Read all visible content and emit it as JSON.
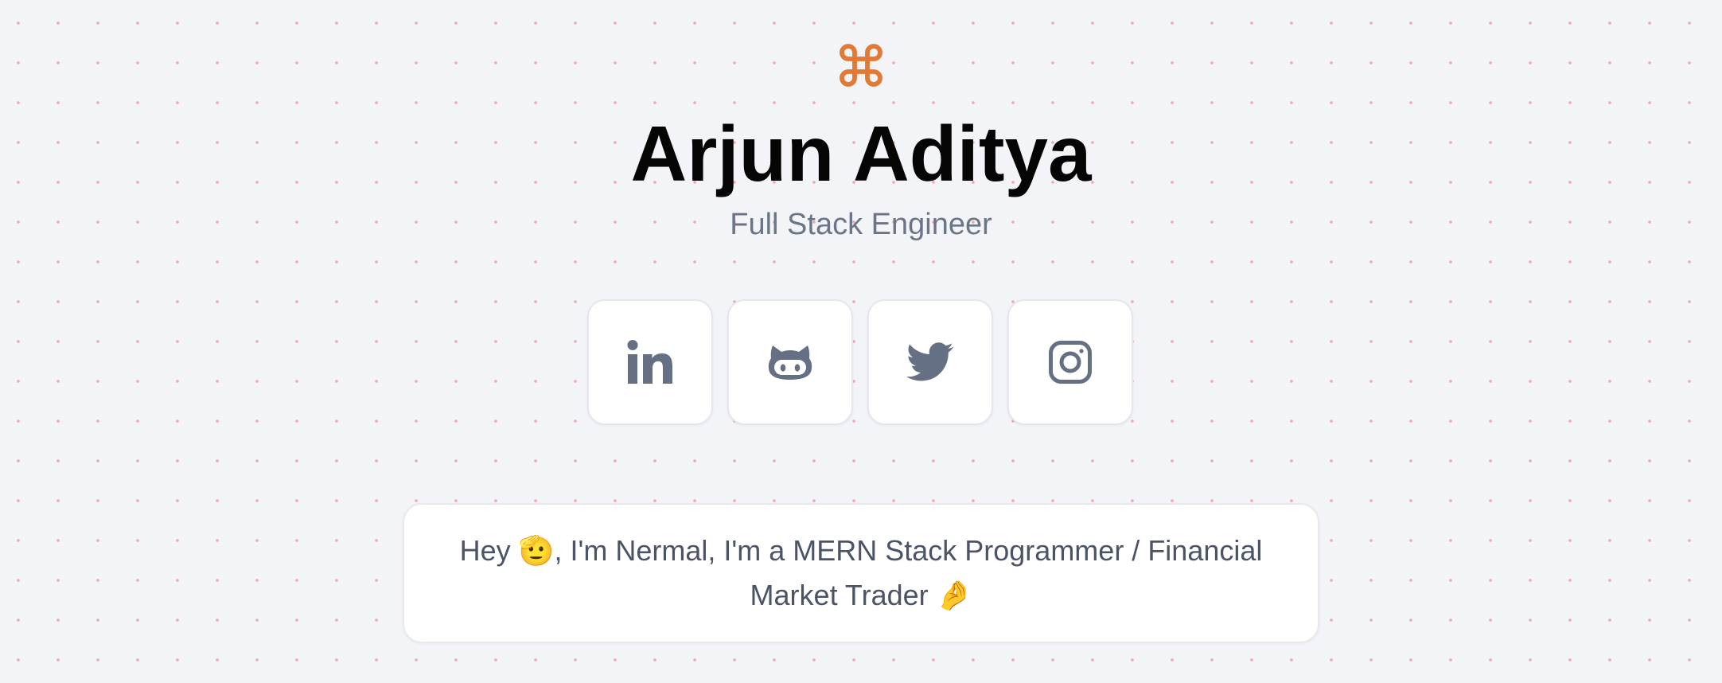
{
  "logo": {
    "icon": "command-key-icon",
    "color": "#e27a35"
  },
  "profile": {
    "name": "Arjun Aditya",
    "role": "Full Stack Engineer"
  },
  "socials": [
    {
      "icon": "linkedin-icon"
    },
    {
      "icon": "github-icon"
    },
    {
      "icon": "twitter-icon"
    },
    {
      "icon": "instagram-icon"
    }
  ],
  "bio": {
    "text": "Hey 🫡, I'm Nermal, I'm a MERN Stack Programmer / Financial Market Trader 🤌"
  },
  "colors": {
    "background": "#f3f4f8",
    "dots": "#f4a3b8",
    "icon": "#667085",
    "accent": "#e27a35"
  }
}
